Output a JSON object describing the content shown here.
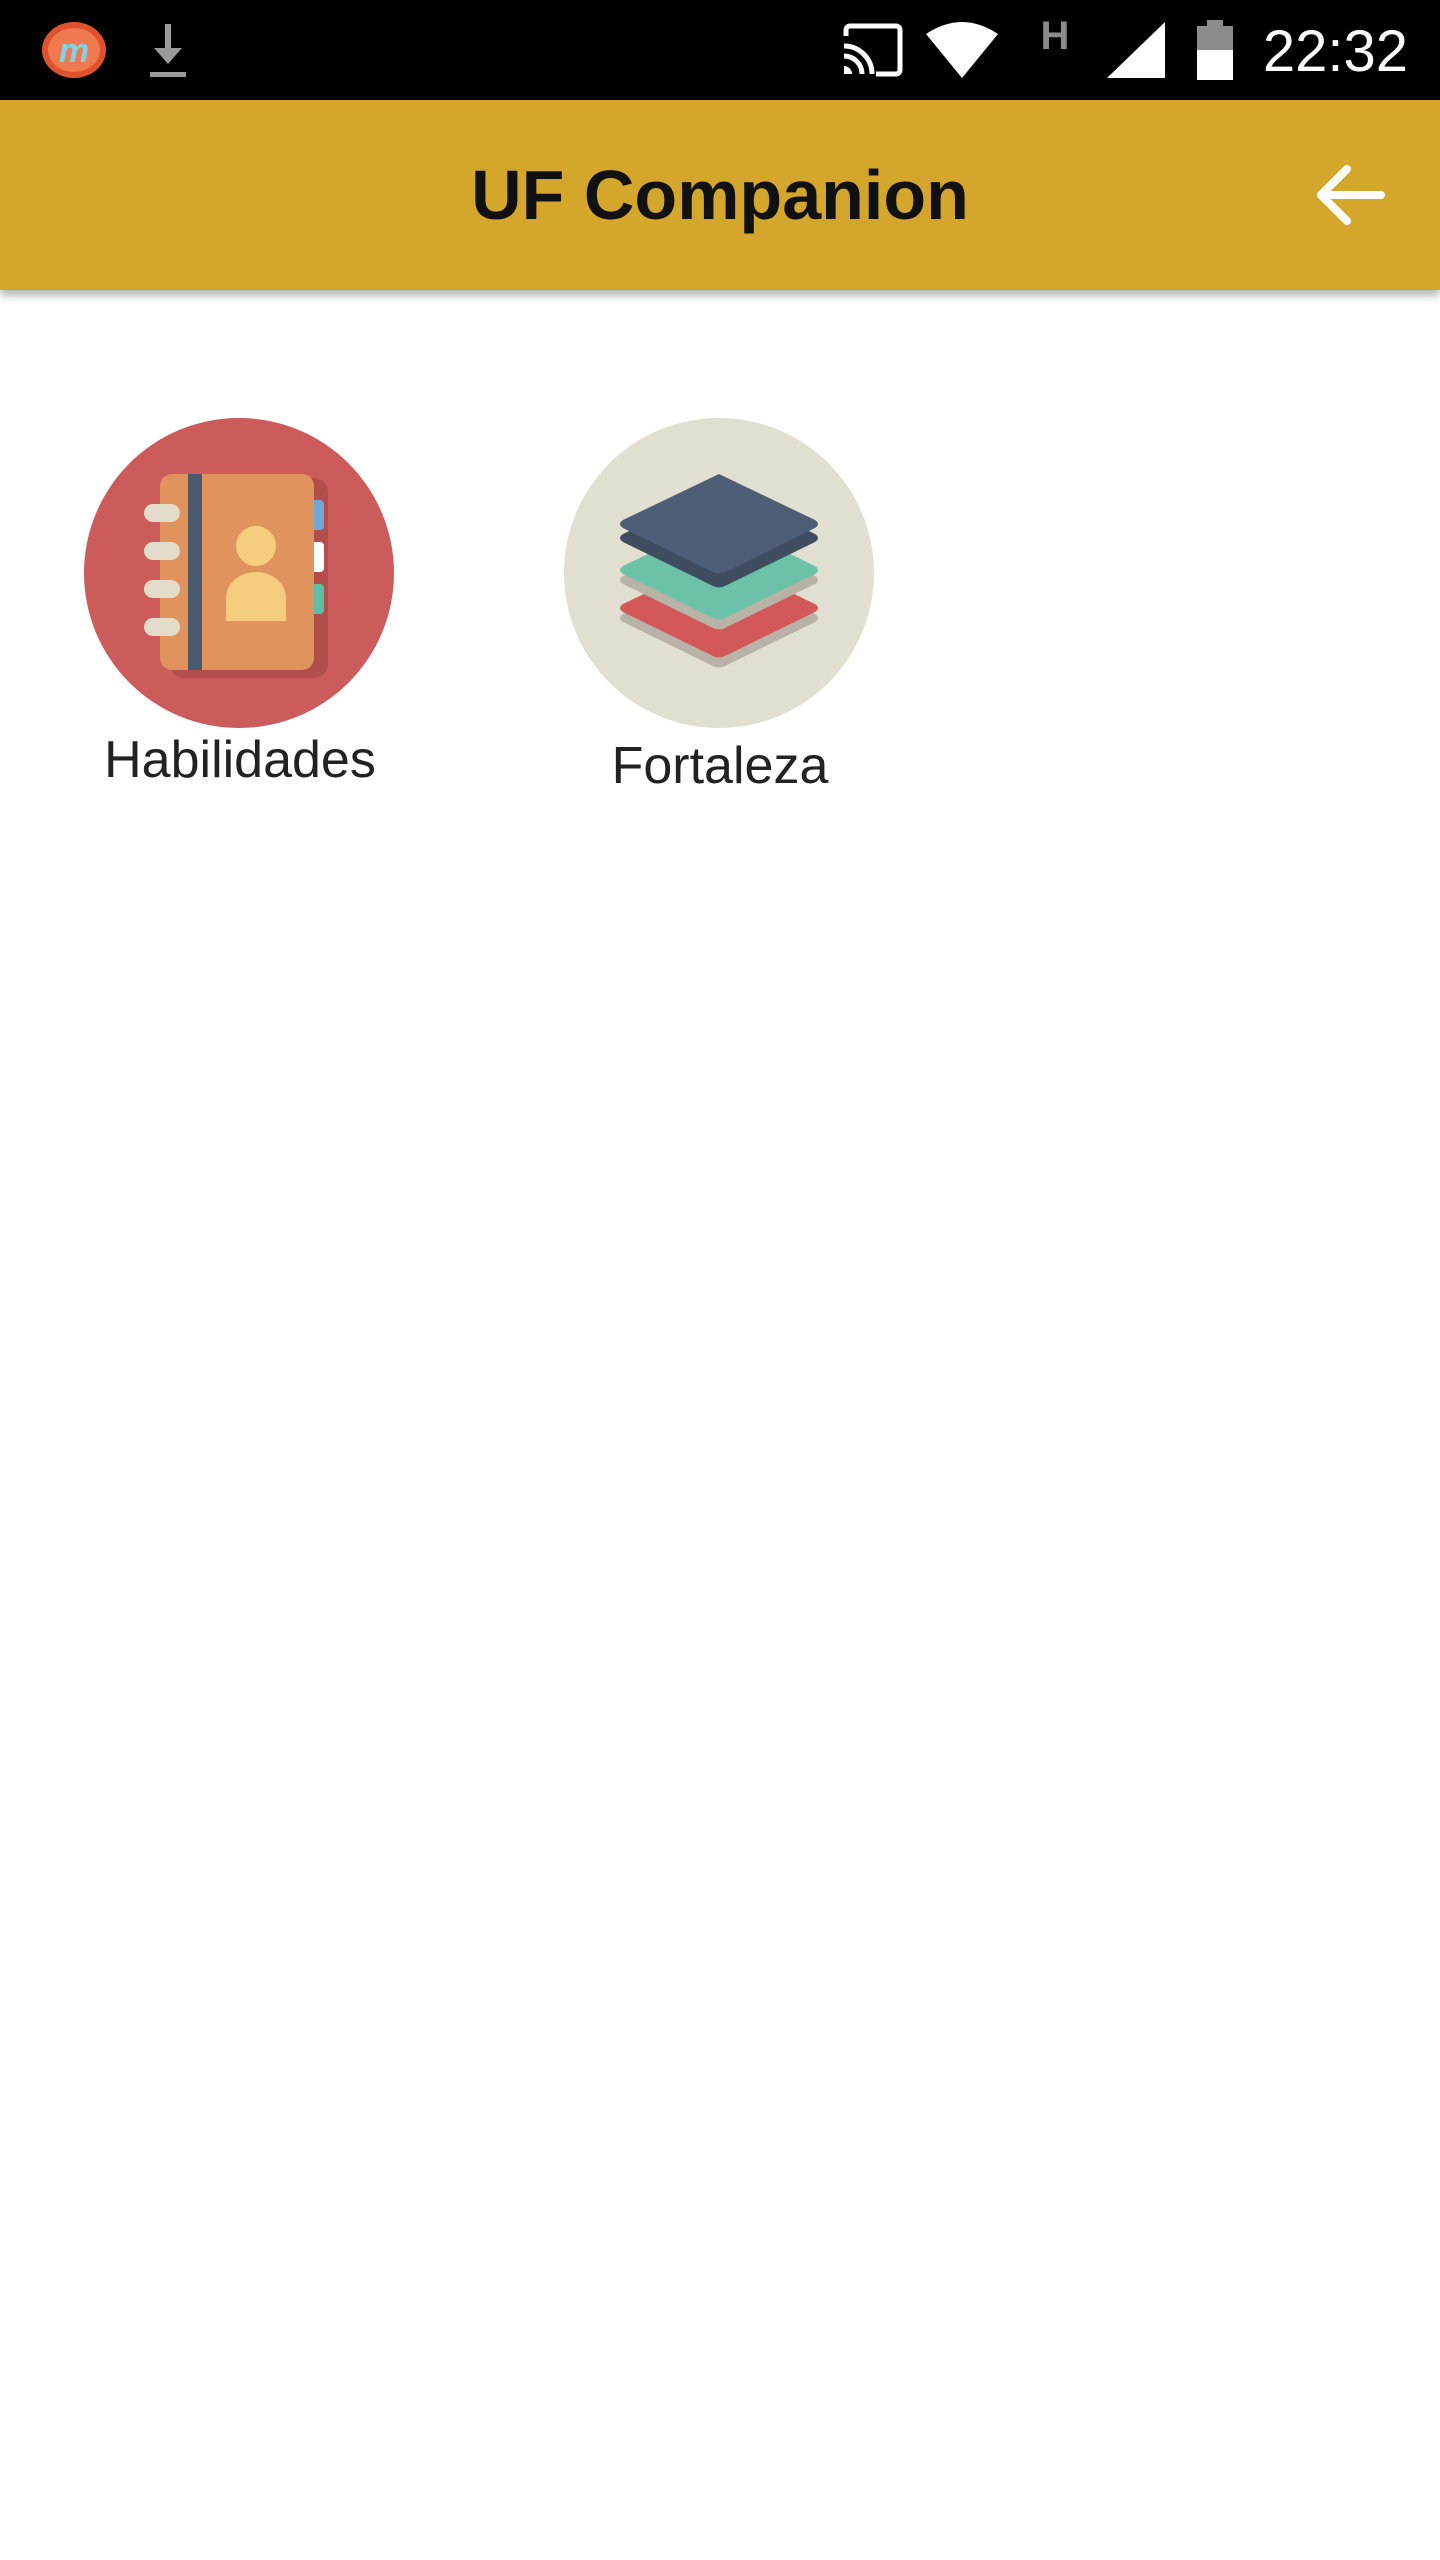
{
  "status_bar": {
    "time": "22:32",
    "network_type": "H",
    "icons": [
      "app-m-icon",
      "download-icon",
      "cast-icon",
      "wifi-icon",
      "signal-icon",
      "battery-icon"
    ]
  },
  "app_bar": {
    "title": "UF Companion",
    "color": "#D4A72C",
    "back_icon": "arrow-back-icon"
  },
  "items": [
    {
      "label": "Habilidades",
      "icon": "address-book-icon",
      "circle_color": "#CB5C5B"
    },
    {
      "label": "Fortaleza",
      "icon": "layers-icon",
      "circle_color": "#E1DFD0"
    }
  ]
}
